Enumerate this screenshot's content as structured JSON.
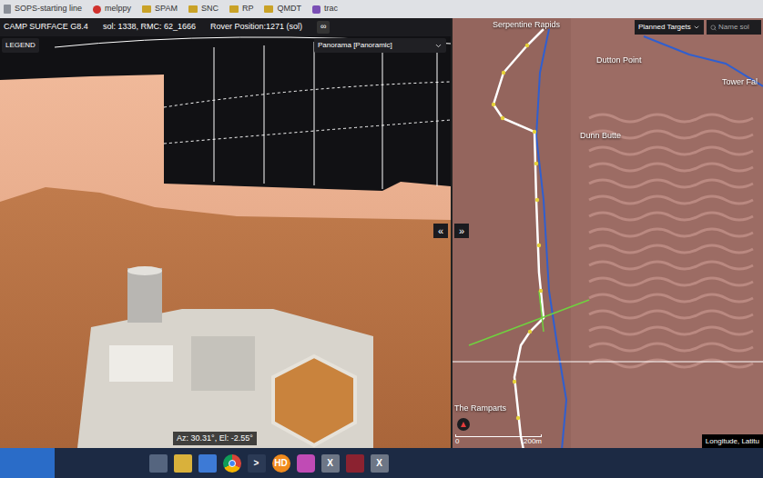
{
  "browser": {
    "bookmarks": [
      {
        "label": "SOPS-starting line",
        "kind": "page"
      },
      {
        "label": "melppy",
        "kind": "app"
      },
      {
        "label": "SPAM",
        "kind": "folder"
      },
      {
        "label": "SNC",
        "kind": "folder"
      },
      {
        "label": "RP",
        "kind": "folder"
      },
      {
        "label": "QMDT",
        "kind": "folder"
      },
      {
        "label": "trac",
        "kind": "tool"
      }
    ]
  },
  "viewer": {
    "title": "CAMP SURFACE G8.4",
    "sol": "sol: 1338, RMC: 62_1666",
    "rover_position": "Rover Position:1271 (sol)",
    "link_button": "∞",
    "legend_button": "LEGEND",
    "view_select": "Panorama [Panoramic]",
    "pointing": "Az: 30.31°, El: -2.55°"
  },
  "divider": {
    "collapse_left": "«",
    "expand_right": "»"
  },
  "map": {
    "layer_select": "Planned Targets",
    "search_placeholder": "Name sol",
    "landmarks": [
      {
        "name": "Serpentine Rapids"
      },
      {
        "name": "Dutton Point"
      },
      {
        "name": "Tower Fal"
      },
      {
        "name": "Dunn Butte"
      },
      {
        "name": "The Ramparts"
      }
    ],
    "scale": {
      "start": "0",
      "end": "200m"
    },
    "coordinates": "Longitude, Latitu"
  },
  "taskbar": {
    "apps": [
      {
        "kind": "start",
        "label": ""
      },
      {
        "kind": "taskview",
        "label": ""
      },
      {
        "kind": "files",
        "label": ""
      },
      {
        "kind": "store",
        "label": ""
      },
      {
        "kind": "chrome",
        "label": ""
      },
      {
        "kind": "terminal",
        "label": ">"
      },
      {
        "kind": "hd",
        "label": "HD"
      },
      {
        "kind": "gem",
        "label": ""
      },
      {
        "kind": "x",
        "label": "X"
      },
      {
        "kind": "red",
        "label": ""
      },
      {
        "kind": "x",
        "label": "X"
      }
    ]
  }
}
